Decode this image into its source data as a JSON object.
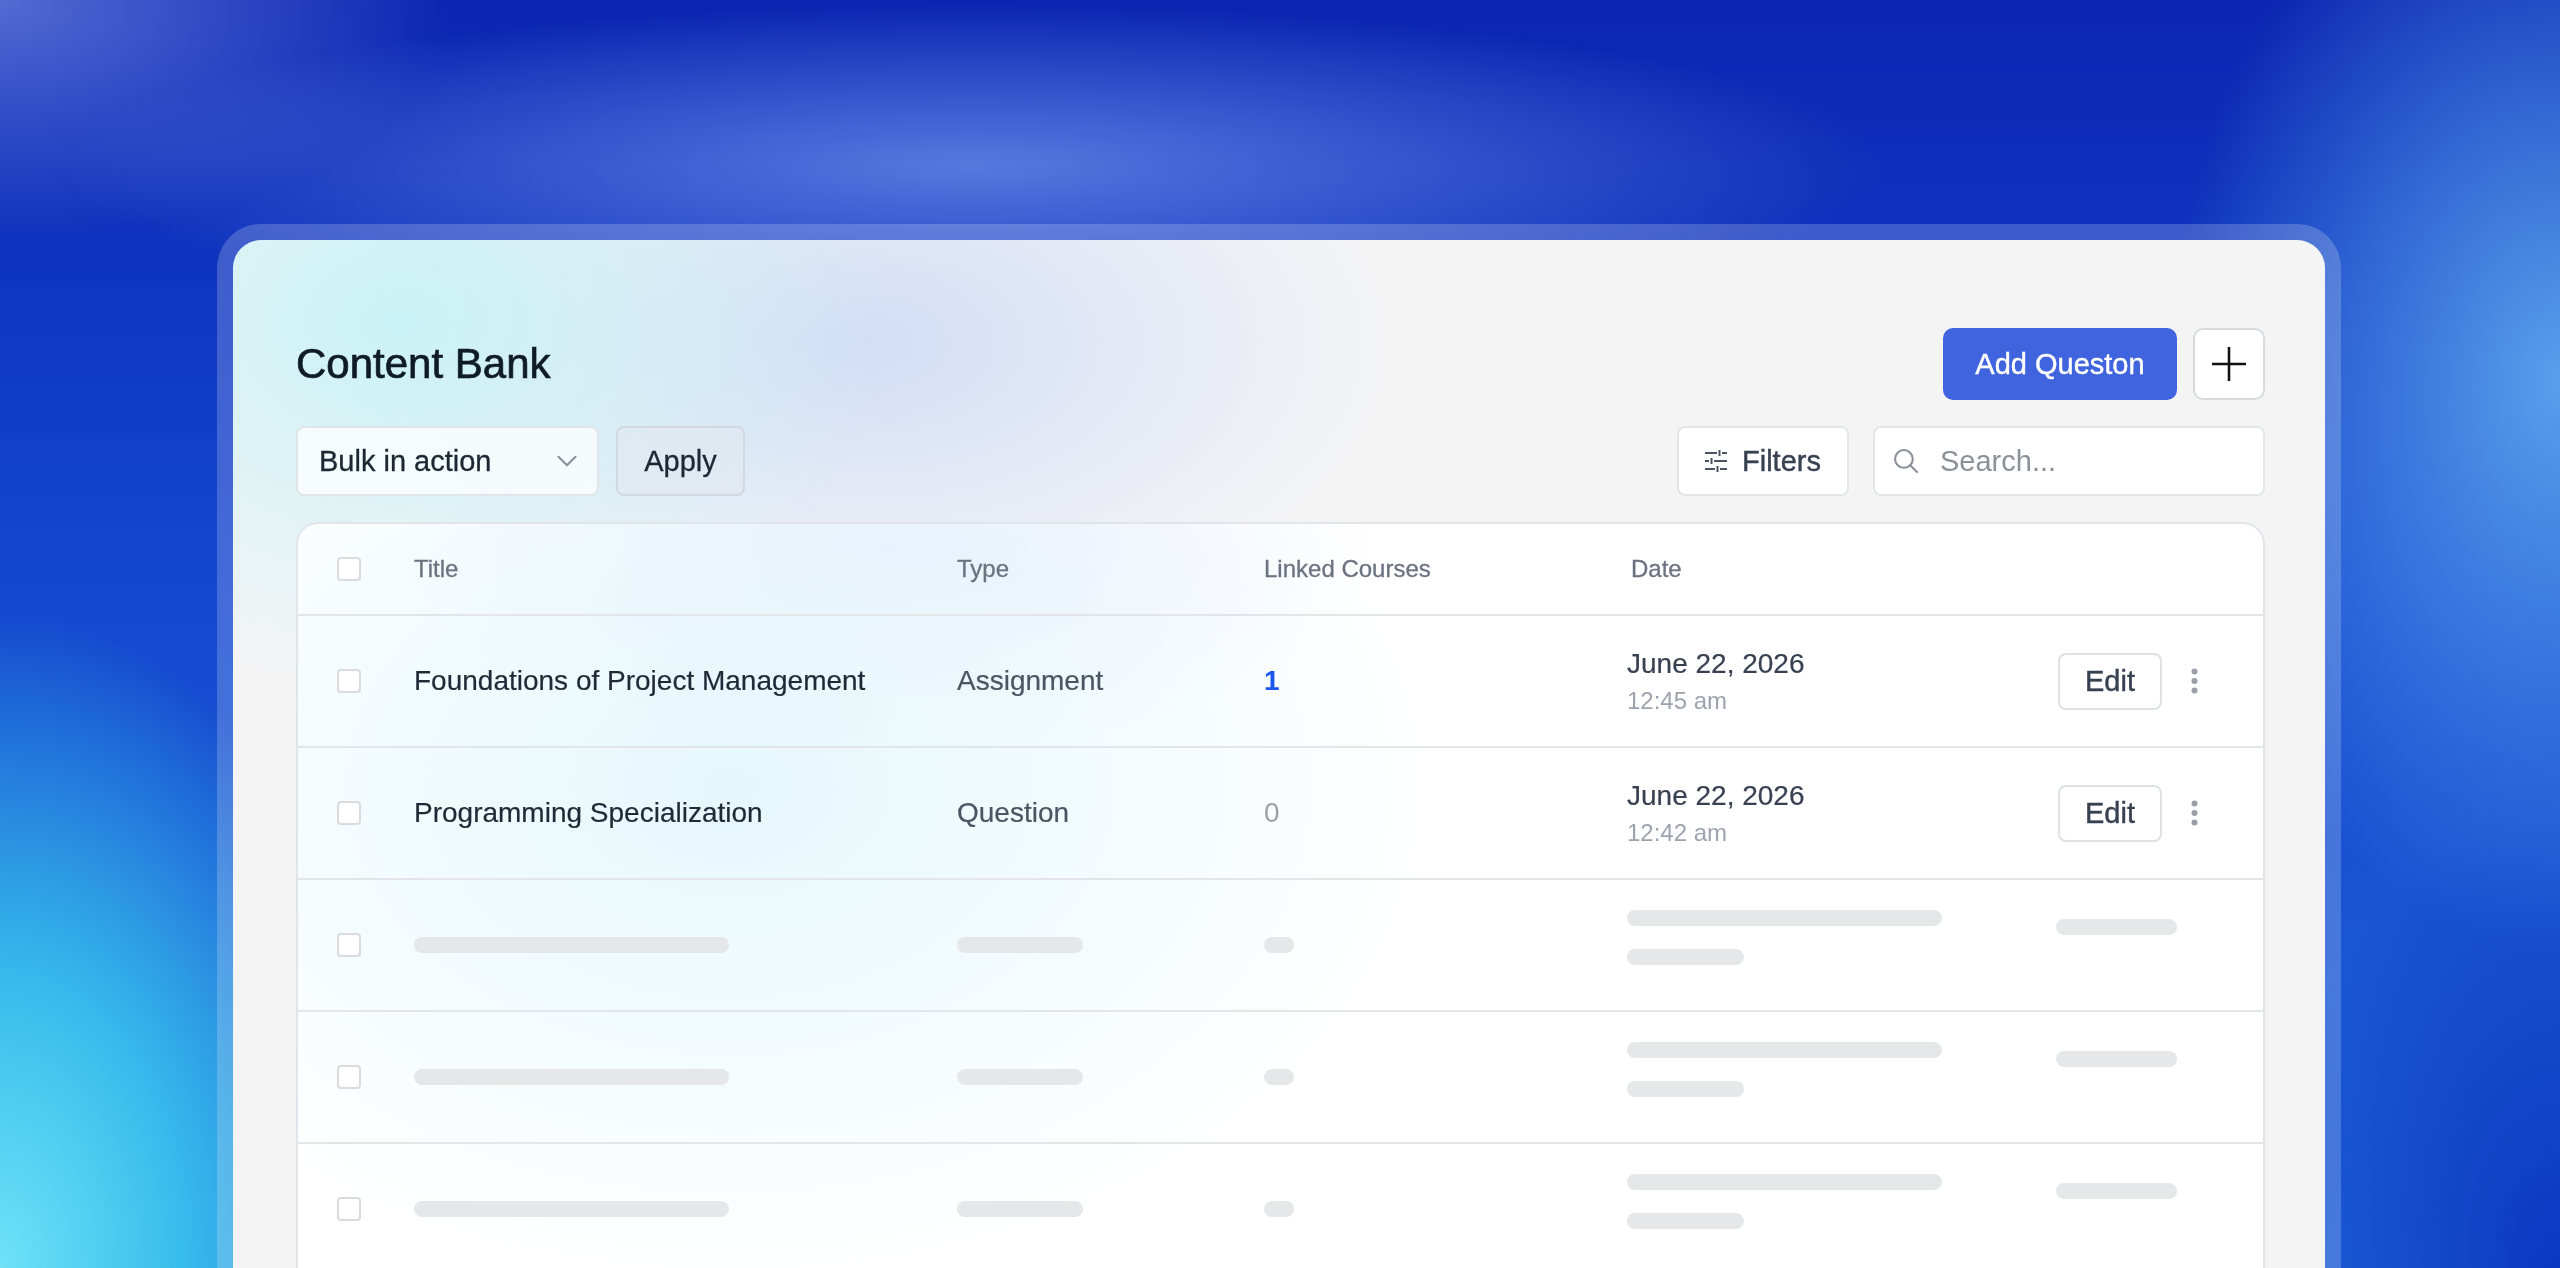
{
  "page": {
    "title": "Content Bank",
    "primary_button": "Add Queston"
  },
  "toolbar": {
    "bulk_action": {
      "value": "Bulk in action"
    },
    "apply_button": "Apply",
    "filters_button": "Filters",
    "search": {
      "placeholder": "Search..."
    }
  },
  "table": {
    "header_checkbox": {
      "checked": false
    },
    "columns": [
      "Title",
      "Type",
      "Linked Courses",
      "Date"
    ],
    "rows": [
      {
        "kind": "item",
        "checked": false,
        "title": "Foundations of Project Management",
        "type": "Assignment",
        "linked_courses": {
          "text": "1",
          "link": true
        },
        "date": "June 22, 2026",
        "time": "12:45 am",
        "action": "Edit"
      },
      {
        "kind": "item",
        "checked": false,
        "title": "Programming Specialization",
        "type": "Question",
        "linked_courses": {
          "text": "0",
          "link": false
        },
        "date": "June 22, 2026",
        "time": "12:42 am",
        "action": "Edit"
      },
      {
        "kind": "skeleton",
        "checked": false
      },
      {
        "kind": "skeleton",
        "checked": false
      },
      {
        "kind": "skeleton",
        "checked": false
      }
    ]
  }
}
